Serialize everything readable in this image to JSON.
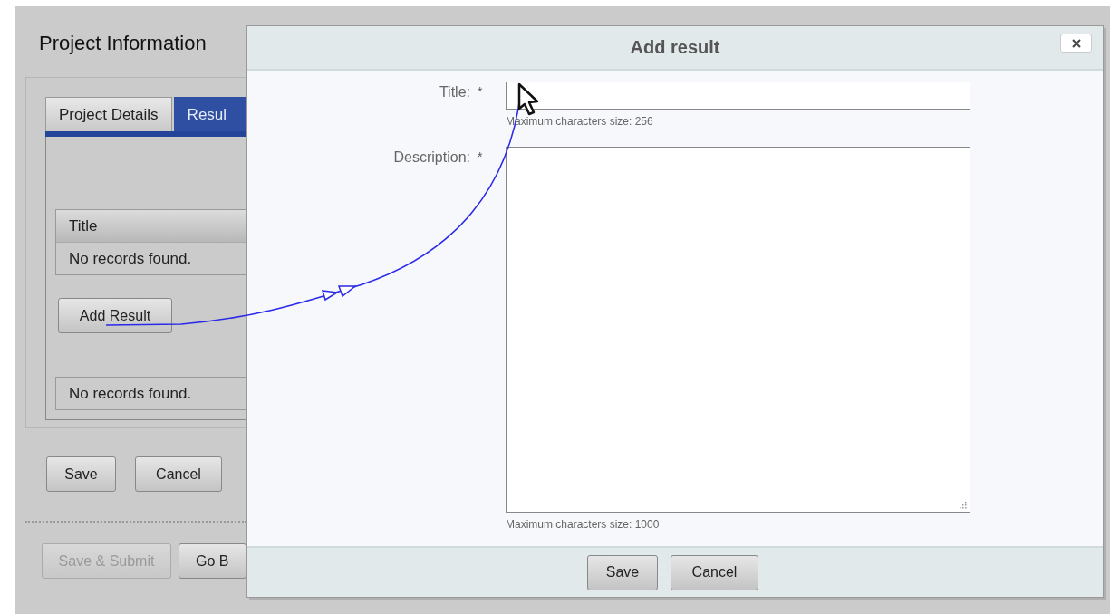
{
  "page": {
    "title": "Project Information",
    "tabs": [
      {
        "label": "Project Details",
        "selected": false
      },
      {
        "label": "Resul",
        "selected": true
      }
    ],
    "results_table": {
      "columns": [
        "Title"
      ],
      "empty_message": "No records found."
    },
    "add_button": "Add Result",
    "second_table": {
      "empty_message": "No records found."
    },
    "buttons": [
      {
        "label": "Save",
        "disabled": false
      },
      {
        "label": "Cancel",
        "disabled": false
      }
    ],
    "footer_buttons": [
      {
        "label": "Save & Submit",
        "disabled": true
      },
      {
        "label": "Go B",
        "disabled": false
      }
    ]
  },
  "dialog": {
    "title": "Add result",
    "fields": [
      {
        "kind": "text",
        "label": "Title:",
        "required_mark": "*",
        "hint": "Maximum characters size: 256"
      },
      {
        "kind": "textarea",
        "label": "Description:",
        "required_mark": "*",
        "hint": "Maximum characters size: 1000"
      }
    ],
    "buttons": [
      "Save",
      "Cancel"
    ]
  }
}
